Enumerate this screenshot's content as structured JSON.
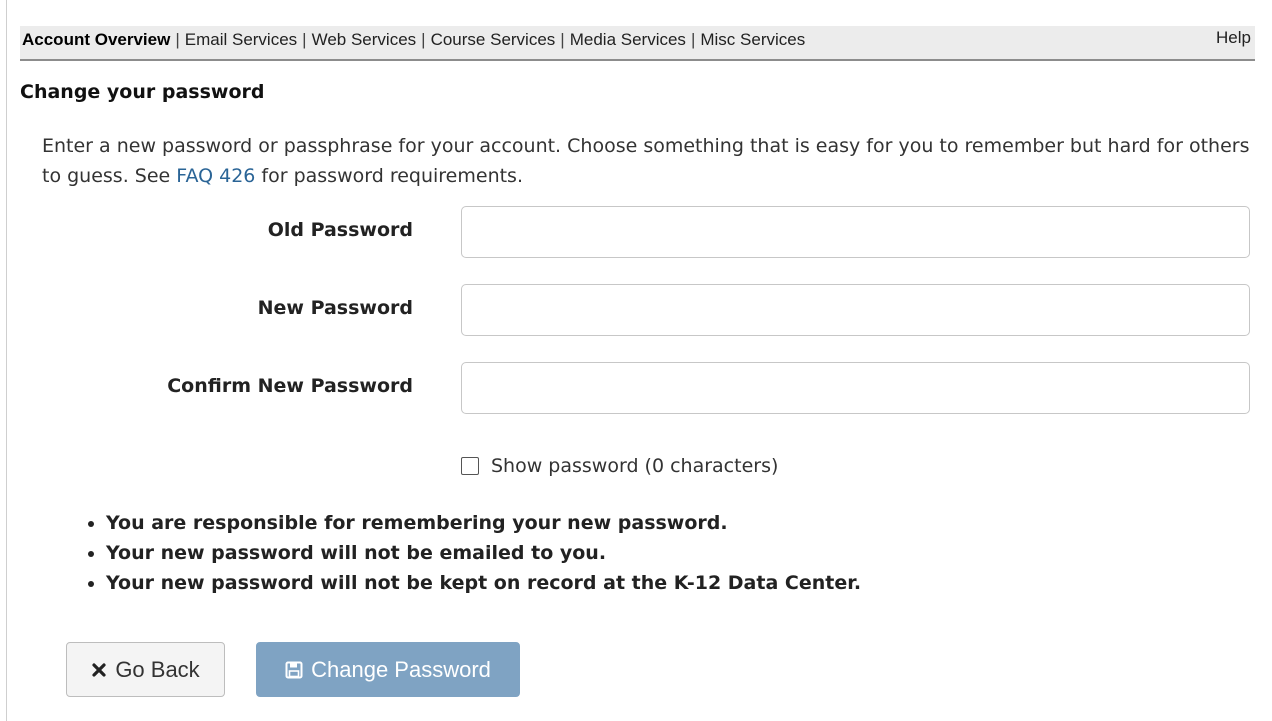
{
  "topnav": {
    "items": [
      {
        "label": "Account Overview"
      },
      {
        "label": "Email Services"
      },
      {
        "label": "Web Services"
      },
      {
        "label": "Course Services"
      },
      {
        "label": "Media Services"
      },
      {
        "label": "Misc Services"
      }
    ],
    "separator": "|",
    "help_label": "Help"
  },
  "section_title": "Change your password",
  "intro": {
    "text_before_link": "Enter a new password or passphrase for your account. Choose something that is easy for you to remember but hard for others to guess. See ",
    "link_text": "FAQ 426",
    "text_after_link": " for password requirements."
  },
  "form": {
    "old_password_label": "Old Password",
    "old_password_value": "",
    "new_password_label": "New Password",
    "new_password_value": "",
    "confirm_password_label": "Confirm New Password",
    "confirm_password_value": "",
    "show_password_label": "Show password (0 characters)",
    "show_password_checked": false
  },
  "notes": [
    "You are responsible for remembering your new password.",
    "Your new password will not be emailed to you.",
    "Your new password will not be kept on record at the K-12 Data Center."
  ],
  "buttons": {
    "go_back_label": "Go Back",
    "go_back_icon": "close-icon",
    "change_password_label": "Change Password",
    "change_password_icon": "save-icon"
  },
  "colors": {
    "link": "#2a6496",
    "primary_button": "#7fa3c3",
    "nav_background": "#ececec"
  }
}
